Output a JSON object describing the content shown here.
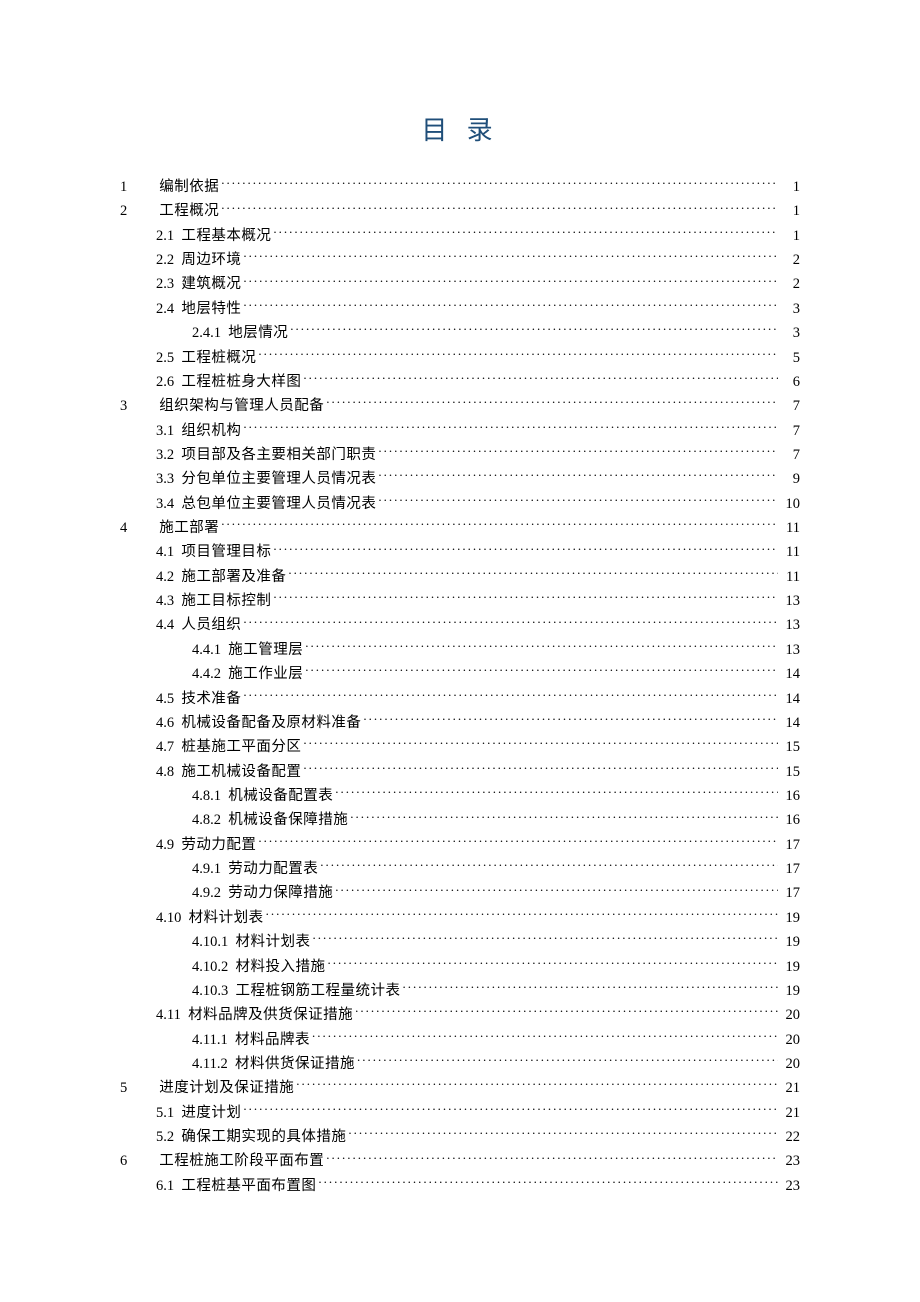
{
  "title": "目 录",
  "toc": [
    {
      "level": 1,
      "num": "1",
      "label": "编制依据",
      "page": "1"
    },
    {
      "level": 1,
      "num": "2",
      "label": "工程概况",
      "page": "1"
    },
    {
      "level": 2,
      "num": "2.1",
      "label": "工程基本概况",
      "page": "1"
    },
    {
      "level": 2,
      "num": "2.2",
      "label": "周边环境",
      "page": "2"
    },
    {
      "level": 2,
      "num": "2.3",
      "label": "建筑概况",
      "page": "2"
    },
    {
      "level": 2,
      "num": "2.4",
      "label": "地层特性",
      "page": "3"
    },
    {
      "level": 3,
      "num": "2.4.1",
      "label": "地层情况",
      "page": "3"
    },
    {
      "level": 2,
      "num": "2.5",
      "label": "工程桩概况",
      "page": "5"
    },
    {
      "level": 2,
      "num": "2.6",
      "label": "工程桩桩身大样图",
      "page": "6"
    },
    {
      "level": 1,
      "num": "3",
      "label": "组织架构与管理人员配备",
      "page": "7"
    },
    {
      "level": 2,
      "num": "3.1",
      "label": "组织机构",
      "page": "7"
    },
    {
      "level": 2,
      "num": "3.2",
      "label": "项目部及各主要相关部门职责",
      "page": "7"
    },
    {
      "level": 2,
      "num": "3.3",
      "label": "分包单位主要管理人员情况表",
      "page": "9"
    },
    {
      "level": 2,
      "num": "3.4",
      "label": "总包单位主要管理人员情况表",
      "page": "10"
    },
    {
      "level": 1,
      "num": "4",
      "label": "施工部署",
      "page": "11"
    },
    {
      "level": 2,
      "num": "4.1",
      "label": "项目管理目标",
      "page": "11"
    },
    {
      "level": 2,
      "num": "4.2",
      "label": "施工部署及准备",
      "page": "11"
    },
    {
      "level": 2,
      "num": "4.3",
      "label": "施工目标控制",
      "page": "13"
    },
    {
      "level": 2,
      "num": "4.4",
      "label": "人员组织",
      "page": "13"
    },
    {
      "level": 3,
      "num": "4.4.1",
      "label": "施工管理层",
      "page": "13"
    },
    {
      "level": 3,
      "num": "4.4.2",
      "label": "施工作业层",
      "page": "14"
    },
    {
      "level": 2,
      "num": "4.5",
      "label": "技术准备",
      "page": "14"
    },
    {
      "level": 2,
      "num": "4.6",
      "label": "机械设备配备及原材料准备",
      "page": "14"
    },
    {
      "level": 2,
      "num": "4.7",
      "label": "桩基施工平面分区",
      "page": "15"
    },
    {
      "level": 2,
      "num": "4.8",
      "label": "施工机械设备配置",
      "page": "15"
    },
    {
      "level": 3,
      "num": "4.8.1",
      "label": "机械设备配置表",
      "page": "16"
    },
    {
      "level": 3,
      "num": "4.8.2",
      "label": "机械设备保障措施",
      "page": "16"
    },
    {
      "level": 2,
      "num": "4.9",
      "label": "劳动力配置",
      "page": "17"
    },
    {
      "level": 3,
      "num": "4.9.1",
      "label": "劳动力配置表",
      "page": "17"
    },
    {
      "level": 3,
      "num": "4.9.2",
      "label": "劳动力保障措施",
      "page": "17"
    },
    {
      "level": 2,
      "num": "4.10",
      "label": "材料计划表",
      "page": "19"
    },
    {
      "level": 3,
      "num": "4.10.1",
      "label": "材料计划表",
      "page": "19"
    },
    {
      "level": 3,
      "num": "4.10.2",
      "label": "材料投入措施",
      "page": "19"
    },
    {
      "level": 3,
      "num": "4.10.3",
      "label": "工程桩钢筋工程量统计表",
      "page": "19"
    },
    {
      "level": 2,
      "num": "4.11",
      "label": "材料品牌及供货保证措施",
      "page": "20"
    },
    {
      "level": 3,
      "num": "4.11.1",
      "label": "材料品牌表",
      "page": "20"
    },
    {
      "level": 3,
      "num": "4.11.2",
      "label": "材料供货保证措施",
      "page": "20"
    },
    {
      "level": 1,
      "num": "5",
      "label": "进度计划及保证措施",
      "page": "21"
    },
    {
      "level": 2,
      "num": "5.1",
      "label": "进度计划",
      "page": "21"
    },
    {
      "level": 2,
      "num": "5.2",
      "label": "确保工期实现的具体措施",
      "page": "22"
    },
    {
      "level": 1,
      "num": "6",
      "label": "工程桩施工阶段平面布置",
      "page": "23"
    },
    {
      "level": 2,
      "num": "6.1",
      "label": "工程桩基平面布置图",
      "page": "23"
    }
  ]
}
